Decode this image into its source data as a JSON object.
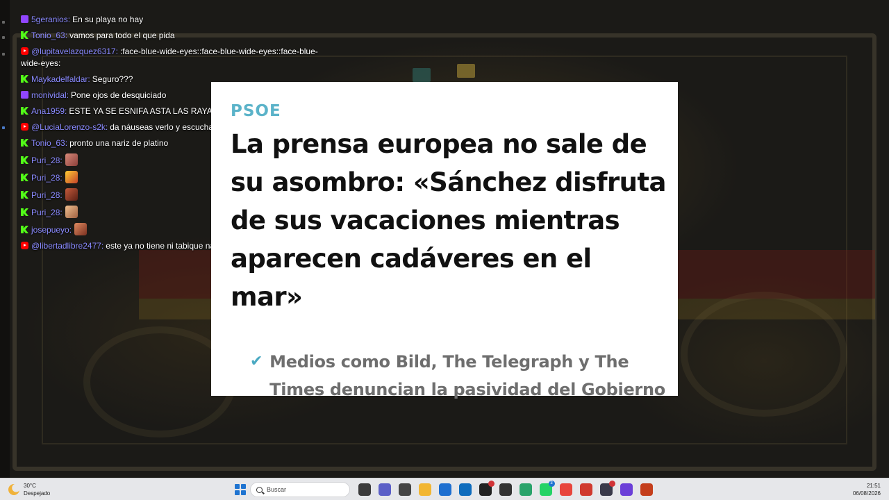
{
  "chat": {
    "messages": [
      {
        "platform": "twitch",
        "user": "5geranios",
        "text": "En su playa no hay"
      },
      {
        "platform": "kick",
        "user": "Tonio_63",
        "text": "vamos para todo el que pida"
      },
      {
        "platform": "youtube",
        "user": "@lupitavelazquez6317",
        "text": ":face-blue-wide-eyes::face-blue-wide-eyes::face-blue-wide-eyes:"
      },
      {
        "platform": "kick",
        "user": "Maykadelfaldar",
        "text": "Seguro???"
      },
      {
        "platform": "twitch",
        "user": "monividal",
        "text": "Pone ojos de desquiciado"
      },
      {
        "platform": "kick",
        "user": "Ana1959",
        "text": "ESTE YA SE ESNIFA ASTA LAS RAYAS CONTINUAS"
      },
      {
        "platform": "youtube",
        "user": "@LuciaLorenzo-s2k",
        "text": "da náuseas verlo y escucharlo"
      },
      {
        "platform": "kick",
        "user": "Tonio_63",
        "text": "pronto una nariz de platino"
      },
      {
        "platform": "kick",
        "user": "Puri_28",
        "text": "",
        "emote": "e1"
      },
      {
        "platform": "kick",
        "user": "Puri_28",
        "text": "",
        "emote": "e2"
      },
      {
        "platform": "kick",
        "user": "Puri_28",
        "text": "",
        "emote": "e3"
      },
      {
        "platform": "kick",
        "user": "Puri_28",
        "text": "",
        "emote": "e4"
      },
      {
        "platform": "kick",
        "user": "josepueyo",
        "text": "",
        "emote": "e5"
      },
      {
        "platform": "youtube",
        "user": "@libertadlibre2477",
        "text": "este ya no tiene ni tabique nasal"
      }
    ]
  },
  "card": {
    "kicker": "PSOE",
    "headline": "La prensa europea no sale de su asombro: «Sánchez disfruta de sus vacaciones mientras aparecen cadáveres en el mar»",
    "subheadline": "Medios como Bild, The Telegraph y The Times denuncian la pasividad del Gobierno",
    "check_icon": "✔"
  },
  "taskbar": {
    "weather": {
      "temp": "30°C",
      "condition": "Despejado"
    },
    "search_placeholder": "Buscar",
    "apps": [
      {
        "name": "task-view-icon",
        "color": "#3b3b3b"
      },
      {
        "name": "teams-icon",
        "color": "#5b5fc7"
      },
      {
        "name": "app-icon",
        "color": "#444444"
      },
      {
        "name": "file-explorer-icon",
        "color": "#f2b632"
      },
      {
        "name": "store-icon",
        "color": "#1e6fd0"
      },
      {
        "name": "outlook-icon",
        "color": "#0f6cbd"
      },
      {
        "name": "app-dark-icon",
        "color": "#222222",
        "badge": "",
        "badge_red": true
      },
      {
        "name": "app-cube-icon",
        "color": "#333333"
      },
      {
        "name": "edge-icon",
        "color": "#2aa36b"
      },
      {
        "name": "whatsapp-icon",
        "color": "#25d366",
        "badge": "3"
      },
      {
        "name": "chrome-icon",
        "color": "#e8453c"
      },
      {
        "name": "chrome-alt-icon",
        "color": "#d0392e"
      },
      {
        "name": "obs-icon",
        "color": "#3a3a4a",
        "badge": "",
        "badge_red": true
      },
      {
        "name": "app-circle-icon",
        "color": "#6b3fd8"
      },
      {
        "name": "powerpoint-icon",
        "color": "#c43e1c"
      }
    ],
    "time": "21:51",
    "date": "06/08/2026"
  }
}
